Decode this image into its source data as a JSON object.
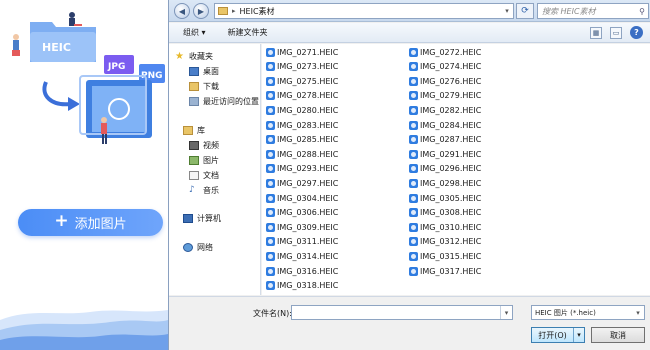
{
  "app": {
    "illustration_labels": {
      "heic": "HEIC",
      "jpg": "JPG",
      "png": "PNG"
    },
    "add_button": "添加图片",
    "accent": "#4b8df6"
  },
  "dialog": {
    "address": {
      "folder": "HEIC素材"
    },
    "search_placeholder": "搜索 HEIC素材",
    "toolbar": {
      "organize": "组织 ▾",
      "new_folder": "新建文件夹",
      "help": "?"
    },
    "nav": {
      "favorites": "收藏夹",
      "desktop": "桌面",
      "downloads": "下载",
      "recent": "最近访问的位置",
      "libraries": "库",
      "videos": "视频",
      "pictures": "图片",
      "documents": "文档",
      "music": "音乐",
      "computer": "计算机",
      "network": "网络"
    },
    "files_left": [
      "IMG_0271.HEIC",
      "IMG_0273.HEIC",
      "IMG_0275.HEIC",
      "IMG_0278.HEIC",
      "IMG_0280.HEIC",
      "IMG_0283.HEIC",
      "IMG_0285.HEIC",
      "IMG_0288.HEIC",
      "IMG_0293.HEIC",
      "IMG_0297.HEIC",
      "IMG_0304.HEIC",
      "IMG_0306.HEIC",
      "IMG_0309.HEIC",
      "IMG_0311.HEIC",
      "IMG_0314.HEIC",
      "IMG_0316.HEIC",
      "IMG_0318.HEIC"
    ],
    "files_right": [
      "IMG_0272.HEIC",
      "IMG_0274.HEIC",
      "IMG_0276.HEIC",
      "IMG_0279.HEIC",
      "IMG_0282.HEIC",
      "IMG_0284.HEIC",
      "IMG_0287.HEIC",
      "IMG_0291.HEIC",
      "IMG_0296.HEIC",
      "IMG_0298.HEIC",
      "IMG_0305.HEIC",
      "IMG_0308.HEIC",
      "IMG_0310.HEIC",
      "IMG_0312.HEIC",
      "IMG_0315.HEIC",
      "IMG_0317.HEIC"
    ],
    "filename_label": "文件名(N):",
    "filename_value": "",
    "filetype_value": "HEIC 图片 (*.heic)",
    "open_button": "打开(O)",
    "cancel_button": "取消"
  }
}
